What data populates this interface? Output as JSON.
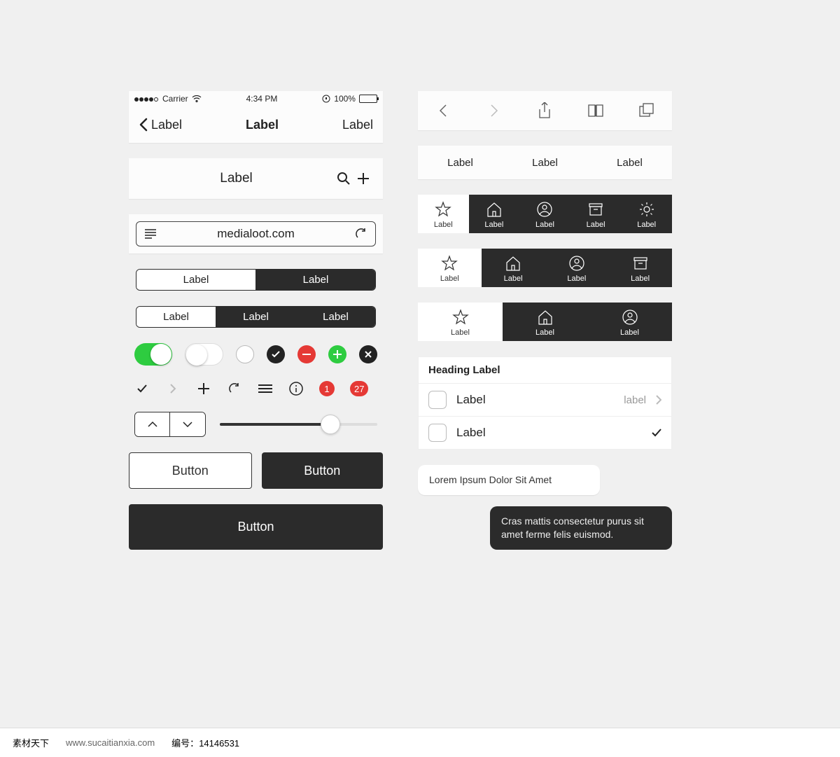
{
  "statusbar": {
    "carrier": "Carrier",
    "time": "4:34 PM",
    "battery": "100%"
  },
  "navbar": {
    "left": "Label",
    "title": "Label",
    "right": "Label"
  },
  "titlebar": {
    "title": "Label"
  },
  "urlbar": {
    "url": "medialoot.com"
  },
  "seg2": [
    "Label",
    "Label"
  ],
  "seg3": [
    "Label",
    "Label",
    "Label"
  ],
  "badge1": "1",
  "badge2": "27",
  "buttons": {
    "light": "Button",
    "dark": "Button",
    "full": "Button"
  },
  "tabs3": [
    "Label",
    "Label",
    "Label"
  ],
  "tabbar5": [
    "Label",
    "Label",
    "Label",
    "Label",
    "Label"
  ],
  "tabbar4": [
    "Label",
    "Label",
    "Label",
    "Label"
  ],
  "tabbar3": [
    "Label",
    "Label",
    "Label"
  ],
  "list": {
    "heading": "Heading Label",
    "rows": [
      {
        "label": "Label",
        "value": "label"
      },
      {
        "label": "Label"
      }
    ]
  },
  "chat": {
    "msg1": "Lorem Ipsum Dolor Sit Amet",
    "msg2": "Cras mattis consectetur purus sit amet ferme felis euismod."
  },
  "footer": {
    "brand": "素材天下",
    "site": "www.sucaitianxia.com",
    "id_label": "编号：",
    "id": "14146531"
  }
}
